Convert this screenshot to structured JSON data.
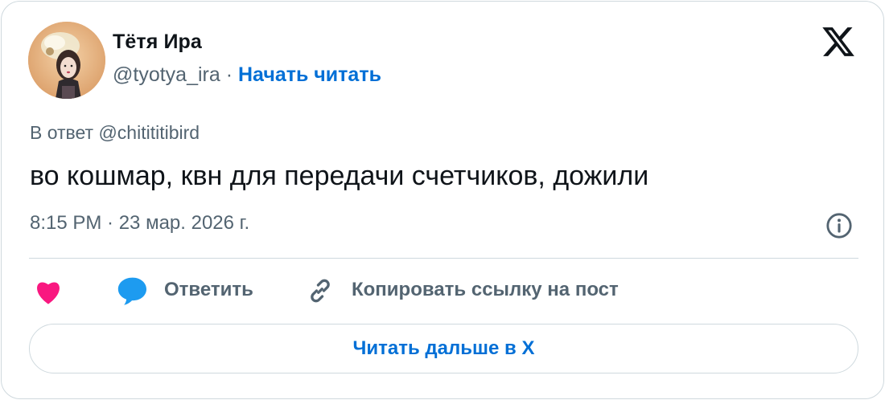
{
  "author": {
    "name": "Тётя Ира",
    "handle": "@tyotya_ira",
    "separator": " · ",
    "follow_label": "Начать читать"
  },
  "tweet": {
    "reply_to": "В ответ @chitititibird",
    "text": "во кошмар, квн для передачи счетчиков, дожили",
    "timestamp": "8:15 PM · 23 мар. 2026 г."
  },
  "actions": {
    "like_icon": "heart-icon",
    "reply_icon": "speech-bubble-icon",
    "reply_label": "Ответить",
    "copy_icon": "link-icon",
    "copy_label": "Копировать ссылку на пост"
  },
  "footer": {
    "read_more_label": "Читать дальше в X"
  },
  "colors": {
    "accent": "#006fd6",
    "text_primary": "#0f1419",
    "text_secondary": "#536471",
    "border": "#cfd9de",
    "like": "#f91880",
    "reply": "#1d9bf0"
  }
}
